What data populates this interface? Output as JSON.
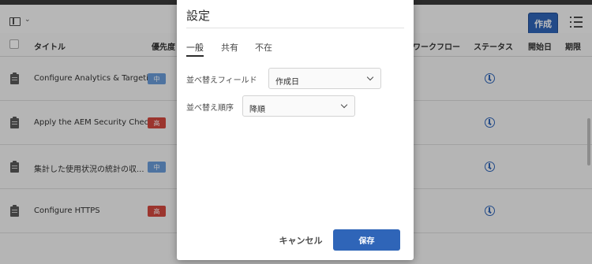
{
  "toolbar": {
    "create_label": "作成"
  },
  "table": {
    "headers": {
      "title": "タイトル",
      "priority": "優先度",
      "workflow": "ワークフロー",
      "status": "ステータス",
      "start_date": "開始日",
      "due_date": "期限"
    },
    "rows": [
      {
        "title": "Configure Analytics & Targeting",
        "priority": "中",
        "priority_color": "#6a9bd8"
      },
      {
        "title": "Apply the AEM Security Checklist",
        "priority": "高",
        "priority_color": "#d2483f"
      },
      {
        "title": "集計した使用状況の統計の収...",
        "priority": "中",
        "priority_color": "#6a9bd8"
      },
      {
        "title": "Configure HTTPS",
        "priority": "高",
        "priority_color": "#d2483f"
      }
    ]
  },
  "dialog": {
    "title": "設定",
    "tabs": [
      "一般",
      "共有",
      "不在"
    ],
    "selected_tab": "一般",
    "sort_field_label": "並べ替えフィールド",
    "sort_field_value": "作成日",
    "sort_order_label": "並べ替え順序",
    "sort_order_value": "降順",
    "cancel_label": "キャンセル",
    "save_label": "保存"
  },
  "colors": {
    "accent": "#2f65b8",
    "priority_medium": "#6a9bd8",
    "priority_high": "#d2483f"
  }
}
